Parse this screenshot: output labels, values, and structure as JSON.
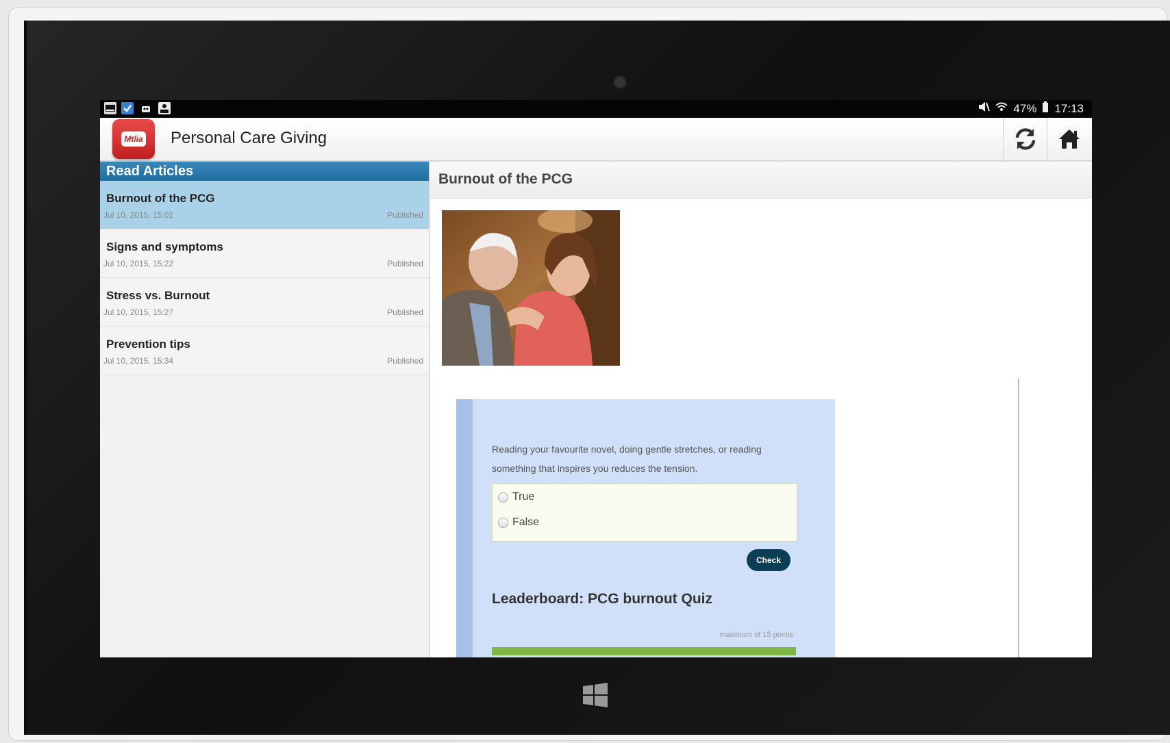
{
  "status_bar": {
    "battery": "47%",
    "time": "17:13",
    "icons": [
      "gallery-icon",
      "task-check-icon",
      "android-icon",
      "reader-icon",
      "mute-icon",
      "wifi-icon",
      "battery-icon"
    ]
  },
  "app": {
    "logo_text": "Mtlia",
    "title": "Personal Care Giving",
    "refresh_icon": "refresh-icon",
    "home_icon": "home-icon"
  },
  "sidebar": {
    "header": "Read Articles",
    "articles": [
      {
        "title": "Burnout of the PCG",
        "date": "Jul 10, 2015, 15:01",
        "status": "Published",
        "selected": true
      },
      {
        "title": "Signs and symptoms",
        "date": "Jul 10, 2015, 15:22",
        "status": "Published",
        "selected": false
      },
      {
        "title": "Stress vs. Burnout",
        "date": "Jul 10, 2015, 15:27",
        "status": "Published",
        "selected": false
      },
      {
        "title": "Prevention tips",
        "date": "Jul 10, 2015, 15:34",
        "status": "Published",
        "selected": false
      }
    ]
  },
  "article": {
    "title": "Burnout of the PCG",
    "quiz": {
      "question": "Reading your favourite novel, doing gentle stretches, or reading something that inspires you reduces the tension.",
      "options": [
        "True",
        "False"
      ],
      "check_label": "Check",
      "leaderboard_title": "Leaderboard: PCG burnout Quiz",
      "max_points": "maximum of 15 points"
    }
  },
  "colors": {
    "selected_row": "#a9d2e8",
    "header_blue": "#1e6ea3",
    "quiz_bg": "#d0e0f9",
    "check_button": "#0c3f55",
    "progress_green": "#7fb64a"
  }
}
